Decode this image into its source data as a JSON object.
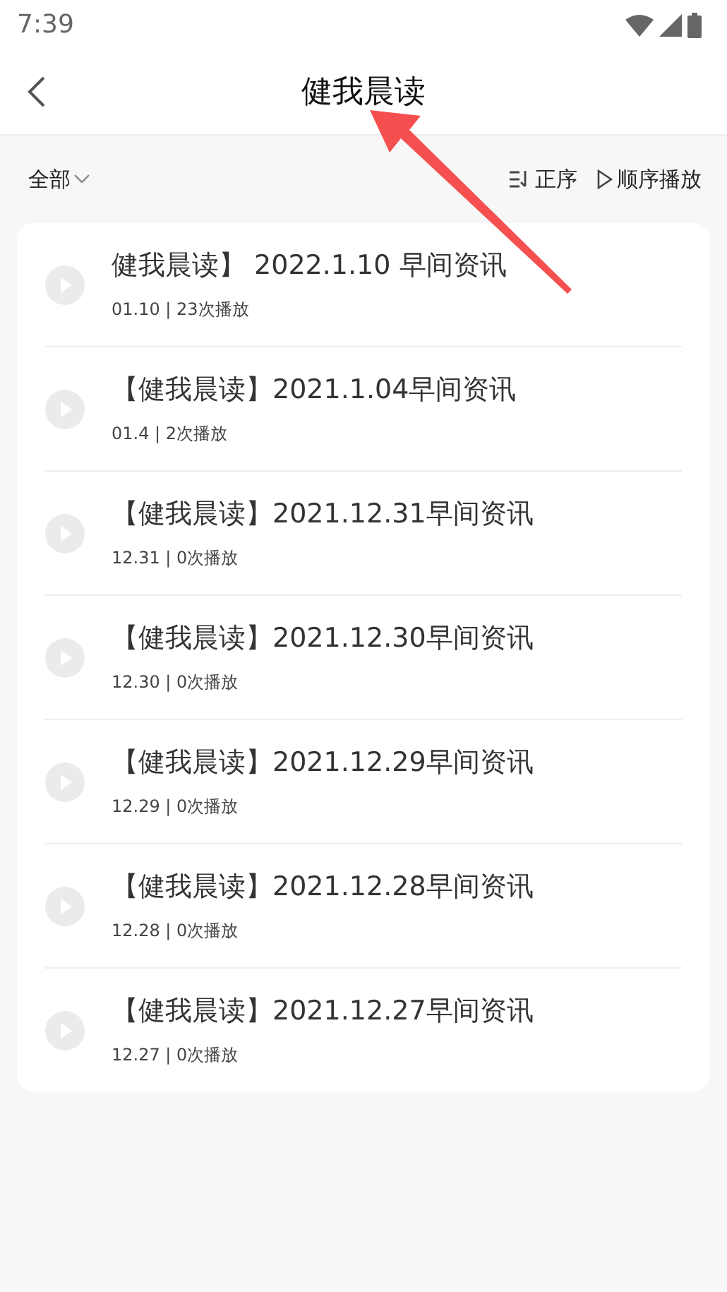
{
  "status_bar": {
    "time": "7:39"
  },
  "header": {
    "title": "健我晨读"
  },
  "filter": {
    "label": "全部"
  },
  "actions": [
    {
      "kind": "sort",
      "label": "正序"
    },
    {
      "kind": "play",
      "label": "顺序播放"
    }
  ],
  "episodes": [
    {
      "title": "健我晨读】 2022.1.10 早间资讯",
      "meta": "01.10 | 23次播放"
    },
    {
      "title": "【健我晨读】2021.1.04早间资讯",
      "meta": "01.4 | 2次播放"
    },
    {
      "title": "【健我晨读】2021.12.31早间资讯",
      "meta": "12.31 | 0次播放"
    },
    {
      "title": "【健我晨读】2021.12.30早间资讯",
      "meta": "12.30 | 0次播放"
    },
    {
      "title": "【健我晨读】2021.12.29早间资讯",
      "meta": "12.29 | 0次播放"
    },
    {
      "title": "【健我晨读】2021.12.28早间资讯",
      "meta": "12.28 | 0次播放"
    },
    {
      "title": "【健我晨读】2021.12.27早间资讯",
      "meta": "12.27 | 0次播放"
    }
  ]
}
